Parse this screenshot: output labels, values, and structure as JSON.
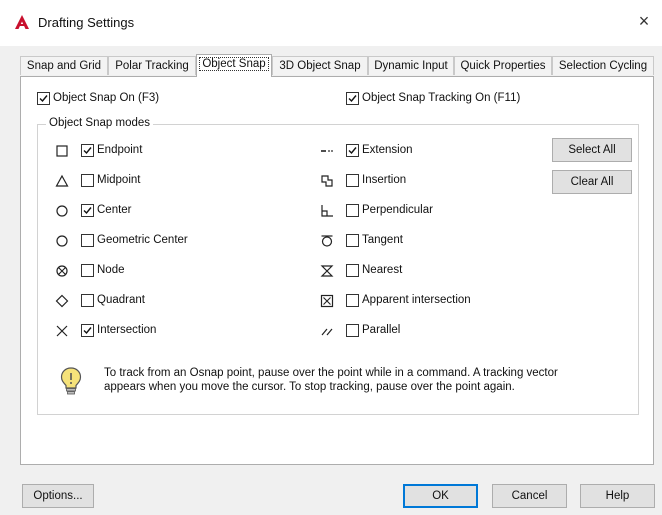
{
  "window": {
    "title": "Drafting Settings",
    "close_glyph": "×",
    "accent": "#c8102e"
  },
  "tabs": [
    {
      "label": "Snap and Grid",
      "active": false
    },
    {
      "label": "Polar Tracking",
      "active": false
    },
    {
      "label": "Object Snap",
      "active": true
    },
    {
      "label": "3D Object Snap",
      "active": false
    },
    {
      "label": "Dynamic Input",
      "active": false
    },
    {
      "label": "Quick Properties",
      "active": false
    },
    {
      "label": "Selection Cycling",
      "active": false
    }
  ],
  "top_options": {
    "osnap_on": {
      "label": "Object Snap On (F3)",
      "checked": true
    },
    "osnap_tracking": {
      "label": "Object Snap Tracking On (F11)",
      "checked": true
    }
  },
  "modes_group": {
    "title": "Object Snap modes",
    "left": [
      {
        "label": "Endpoint",
        "checked": true,
        "icon": "endpoint-icon"
      },
      {
        "label": "Midpoint",
        "checked": false,
        "icon": "midpoint-icon"
      },
      {
        "label": "Center",
        "checked": true,
        "icon": "center-icon"
      },
      {
        "label": "Geometric Center",
        "checked": false,
        "icon": "geometric-center-icon"
      },
      {
        "label": "Node",
        "checked": false,
        "icon": "node-icon"
      },
      {
        "label": "Quadrant",
        "checked": false,
        "icon": "quadrant-icon"
      },
      {
        "label": "Intersection",
        "checked": true,
        "icon": "intersection-icon"
      }
    ],
    "right": [
      {
        "label": "Extension",
        "checked": true,
        "icon": "extension-icon"
      },
      {
        "label": "Insertion",
        "checked": false,
        "icon": "insertion-icon"
      },
      {
        "label": "Perpendicular",
        "checked": false,
        "icon": "perpendicular-icon"
      },
      {
        "label": "Tangent",
        "checked": false,
        "icon": "tangent-icon"
      },
      {
        "label": "Nearest",
        "checked": false,
        "icon": "nearest-icon"
      },
      {
        "label": "Apparent intersection",
        "checked": false,
        "icon": "apparent-intersection-icon"
      },
      {
        "label": "Parallel",
        "checked": false,
        "icon": "parallel-icon"
      }
    ],
    "select_all_label": "Select All",
    "clear_all_label": "Clear All",
    "hint_icon": "lightbulb-icon",
    "hint_line1": "To track from an Osnap point, pause over the point while in a command.  A tracking vector",
    "hint_line2": "appears when you move the cursor.  To stop tracking, pause over the point again."
  },
  "footer": {
    "options_label": "Options...",
    "ok_label": "OK",
    "cancel_label": "Cancel",
    "help_label": "Help"
  }
}
